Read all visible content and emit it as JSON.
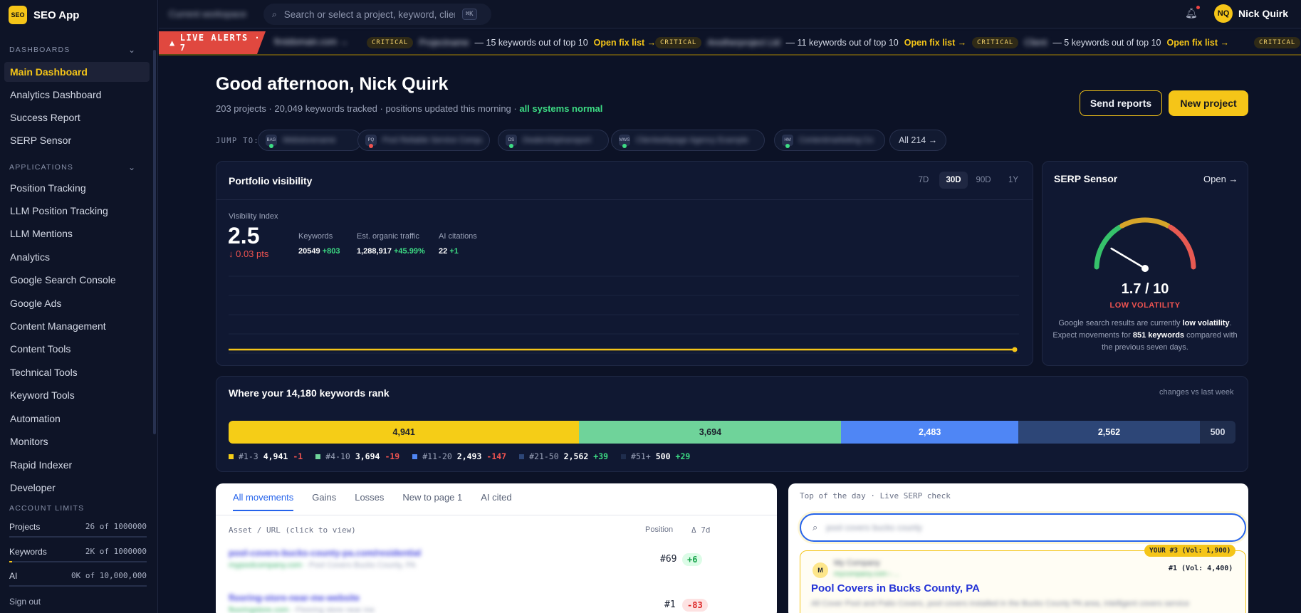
{
  "brand": {
    "logo": "SEO",
    "name": "SEO App"
  },
  "sidebar": {
    "dashboards_title": "DASHBOARDS",
    "dashboards": [
      {
        "label": "Main Dashboard"
      },
      {
        "label": "Analytics Dashboard"
      },
      {
        "label": "Success Report"
      },
      {
        "label": "SERP Sensor"
      }
    ],
    "applications_title": "APPLICATIONS",
    "applications": [
      {
        "label": "Position Tracking"
      },
      {
        "label": "LLM Position Tracking"
      },
      {
        "label": "LLM Mentions"
      },
      {
        "label": "Analytics"
      },
      {
        "label": "Google Search Console"
      },
      {
        "label": "Google Ads"
      },
      {
        "label": "Content Management"
      },
      {
        "label": "Content Tools"
      },
      {
        "label": "Technical Tools"
      },
      {
        "label": "Keyword Tools"
      },
      {
        "label": "Automation"
      },
      {
        "label": "Monitors"
      },
      {
        "label": "Rapid Indexer"
      },
      {
        "label": "Developer"
      }
    ],
    "limits_title": "ACCOUNT LIMITS",
    "limits": [
      {
        "label": "Projects",
        "value": "26 of 1000000",
        "fill": 0.0
      },
      {
        "label": "Keywords",
        "value": "2K of 1000000",
        "fill": 0.01
      },
      {
        "label": "AI",
        "value": "0K of 10,000,000",
        "fill": 0.0
      }
    ],
    "signout": "Sign out"
  },
  "topbar": {
    "blurred_context": "Current workspace",
    "search_placeholder": "Search or select a project, keyword, client...",
    "search_shortcut": "⌘K",
    "user_initials": "NQ",
    "user_name": "Nick Quirk",
    "icons": {
      "search": "search-icon",
      "bell": "bell-icon"
    }
  },
  "alerts": {
    "label": "LIVE ALERTS · 7",
    "lead_blurred": "firstdomain.com →",
    "items": [
      {
        "badge": "CRITICAL",
        "site": "Projectname",
        "text": "— 15 keywords out of top 10",
        "link": "Open fix list →"
      },
      {
        "badge": "CRITICAL",
        "site": "Anotherproject Ltd",
        "text": "— 11 keywords out of top 10",
        "link": "Open fix list →"
      },
      {
        "badge": "CRITICAL",
        "site": "Client",
        "text": "— 5 keywords out of top 10",
        "link": "Open fix list →"
      },
      {
        "badge": "CRITICAL",
        "site": "",
        "text": "",
        "link": ""
      }
    ]
  },
  "header": {
    "greeting": "Good afternoon, Nick Quirk",
    "subline": "203 projects · 20,049 keywords tracked · positions updated this morning · ",
    "status": "all systems normal",
    "send_reports": "Send reports",
    "new_project": "New project"
  },
  "jump": {
    "label": "JUMP TO:",
    "chips": [
      {
        "icon": "BAG",
        "name": "Webstorename",
        "dot": "#3ddc84"
      },
      {
        "icon": "PQ",
        "name": "Pool Reliable Service Company",
        "dot": "#ef5350"
      },
      {
        "icon": "DS",
        "name": "Dealershiptransport",
        "dot": "#3ddc84"
      },
      {
        "icon": "MWS",
        "name": "Clientwebpage Agency Example",
        "dot": "#3ddc84"
      },
      {
        "icon": "HM",
        "name": "Contentmarketing Co",
        "dot": "#3ddc84"
      }
    ],
    "all": "All 214 →"
  },
  "portfolio": {
    "title": "Portfolio visibility",
    "ranges": [
      "7D",
      "30D",
      "90D",
      "1Y"
    ],
    "active_range": "30D",
    "vis_label": "Visibility Index",
    "vis_value": "2.5",
    "vis_delta": "↓ 0.03 pts",
    "metrics": [
      {
        "label": "Keywords",
        "value": "20549",
        "delta": "+803"
      },
      {
        "label": "Est. organic traffic",
        "value": "1,288,917",
        "delta": "+45.99%"
      },
      {
        "label": "AI citations",
        "value": "22",
        "delta": "+1"
      }
    ]
  },
  "chart_data": {
    "type": "line",
    "title": "",
    "xlabel": "",
    "ylabel": "",
    "series": [
      {
        "values": [
          2.5,
          2.5,
          2.5,
          2.5,
          2.5,
          2.5,
          2.5,
          2.5,
          2.5,
          2.5
        ]
      }
    ],
    "color": "#f5c518",
    "grid": true
  },
  "serp_sensor": {
    "title": "SERP Sensor",
    "open": "Open →",
    "score": "1.7 / 10",
    "score_value": 1.7,
    "score_max": 10,
    "level": "LOW VOLATILITY",
    "desc_pre": "Google search results are currently ",
    "desc_low": "low volatility",
    "desc_mid": ". Expect movements for ",
    "desc_kw": "851 keywords",
    "desc_post": " compared with the previous seven days."
  },
  "ranks": {
    "title": "Where your 14,180 keywords rank",
    "note": "changes vs last week",
    "segments": [
      {
        "name": "#1-3",
        "value": 4941,
        "label": "4,941",
        "delta": "-1",
        "color": "#f5cd17",
        "text_color": "#1b1f2b",
        "delta_color": "#ef5350"
      },
      {
        "name": "#4-10",
        "value": 3694,
        "label": "3,694",
        "delta": "-19",
        "color": "#6fd39a",
        "text_color": "#1b1f2b",
        "delta_color": "#ef5350"
      },
      {
        "name": "#11-20",
        "value": 2493,
        "label": "2,483",
        "delta": "-147",
        "color": "#4f86f5",
        "text_color": "#ffffff",
        "delta_color": "#ef5350"
      },
      {
        "name": "#21-50",
        "value": 2562,
        "label": "2,562",
        "delta": "+39",
        "color": "#2d4677",
        "text_color": "#ffffff",
        "delta_color": "#3ddc84"
      },
      {
        "name": "#51+",
        "value": 500,
        "label": "500",
        "delta": "+29",
        "color": "#1f2d4d",
        "text_color": "#d5dae7",
        "delta_color": "#3ddc84"
      }
    ],
    "legend_values": [
      "4,941",
      "3,694",
      "2,493",
      "2,562",
      "500"
    ]
  },
  "movements": {
    "tabs": [
      "All movements",
      "Gains",
      "Losses",
      "New to page 1",
      "AI cited"
    ],
    "active_tab": "All movements",
    "col_asset": "Asset / URL (click to view)",
    "col_position": "Position",
    "col_delta": "Δ 7d",
    "rows": [
      {
        "url": "pool-covers-bucks-county-pa.com/residential",
        "domain": "mypoolcompany.com",
        "keyword": "Pool Covers Bucks County, PA",
        "position": "#69",
        "change": "+6",
        "dir": "up"
      },
      {
        "url": "flooring-store-near-me-website",
        "domain": "flooringstore.com",
        "keyword": "Flooring store near me",
        "position": "#1",
        "change": "-83",
        "dir": "down"
      }
    ]
  },
  "serp_check": {
    "header": "Top of the day · Live SERP check",
    "query": "pool covers bucks county",
    "your_badge": "YOUR #3 (Vol: 1,900)",
    "vol": "#1 (Vol: 4,400)",
    "favicon": "M",
    "site": "My Company",
    "url": "mycompany.com › ...",
    "title": "Pool Covers in Bucks County, PA",
    "snippet": "All Cover Pool and Patio Covers, pool covers installed in the Bucks County PA area, intelligent covers service"
  }
}
